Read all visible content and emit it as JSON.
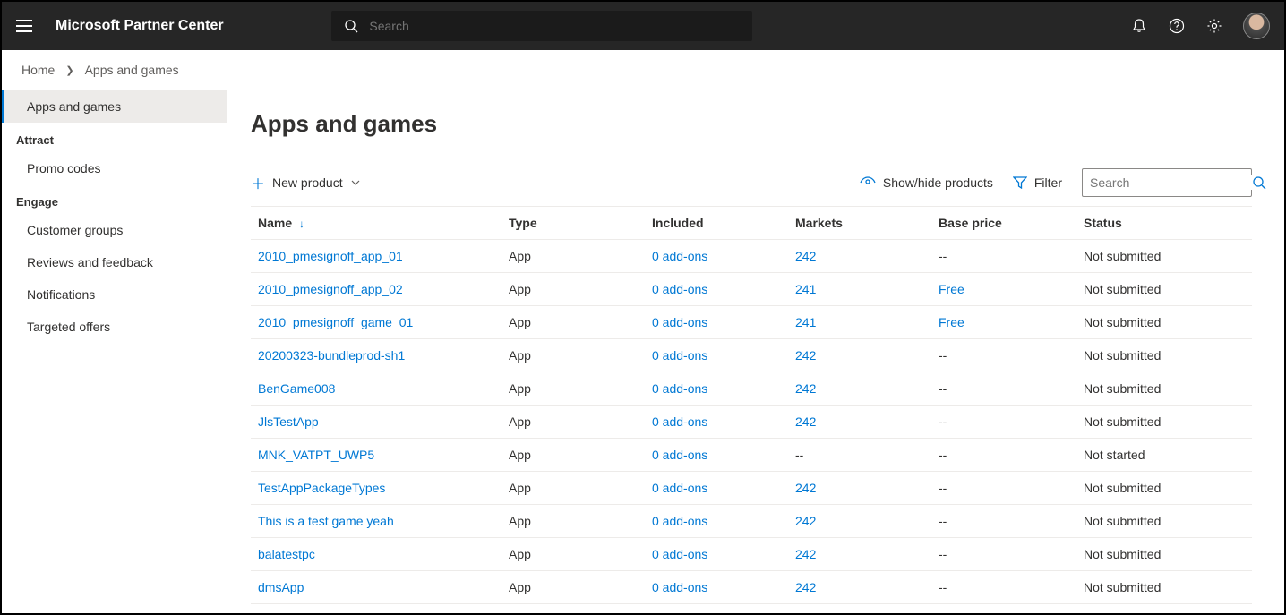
{
  "header": {
    "title": "Microsoft Partner Center",
    "search_placeholder": "Search"
  },
  "breadcrumb": {
    "home": "Home",
    "current": "Apps and games"
  },
  "sidebar": {
    "active": "Apps and games",
    "groups": [
      {
        "heading": "Attract",
        "items": [
          "Promo codes"
        ]
      },
      {
        "heading": "Engage",
        "items": [
          "Customer groups",
          "Reviews and feedback",
          "Notifications",
          "Targeted offers"
        ]
      }
    ]
  },
  "page": {
    "title": "Apps and games",
    "new_product": "New product",
    "show_hide": "Show/hide products",
    "filter": "Filter",
    "search_placeholder": "Search"
  },
  "table": {
    "columns": {
      "name": "Name",
      "type": "Type",
      "included": "Included",
      "markets": "Markets",
      "price": "Base price",
      "status": "Status"
    },
    "rows": [
      {
        "name": "2010_pmesignoff_app_01",
        "type": "App",
        "included": "0 add-ons",
        "markets": "242",
        "price": "--",
        "status": "Not submitted"
      },
      {
        "name": "2010_pmesignoff_app_02",
        "type": "App",
        "included": "0 add-ons",
        "markets": "241",
        "price": "Free",
        "status": "Not submitted"
      },
      {
        "name": "2010_pmesignoff_game_01",
        "type": "App",
        "included": "0 add-ons",
        "markets": "241",
        "price": "Free",
        "status": "Not submitted"
      },
      {
        "name": "20200323-bundleprod-sh1",
        "type": "App",
        "included": "0 add-ons",
        "markets": "242",
        "price": "--",
        "status": "Not submitted"
      },
      {
        "name": "BenGame008",
        "type": "App",
        "included": "0 add-ons",
        "markets": "242",
        "price": "--",
        "status": "Not submitted"
      },
      {
        "name": "JlsTestApp",
        "type": "App",
        "included": "0 add-ons",
        "markets": "242",
        "price": "--",
        "status": "Not submitted"
      },
      {
        "name": "MNK_VATPT_UWP5",
        "type": "App",
        "included": "0 add-ons",
        "markets": "--",
        "price": "--",
        "status": "Not started"
      },
      {
        "name": "TestAppPackageTypes",
        "type": "App",
        "included": "0 add-ons",
        "markets": "242",
        "price": "--",
        "status": "Not submitted"
      },
      {
        "name": "This is a test game yeah",
        "type": "App",
        "included": "0 add-ons",
        "markets": "242",
        "price": "--",
        "status": "Not submitted"
      },
      {
        "name": "balatestpc",
        "type": "App",
        "included": "0 add-ons",
        "markets": "242",
        "price": "--",
        "status": "Not submitted"
      },
      {
        "name": "dmsApp",
        "type": "App",
        "included": "0 add-ons",
        "markets": "242",
        "price": "--",
        "status": "Not submitted"
      }
    ]
  }
}
